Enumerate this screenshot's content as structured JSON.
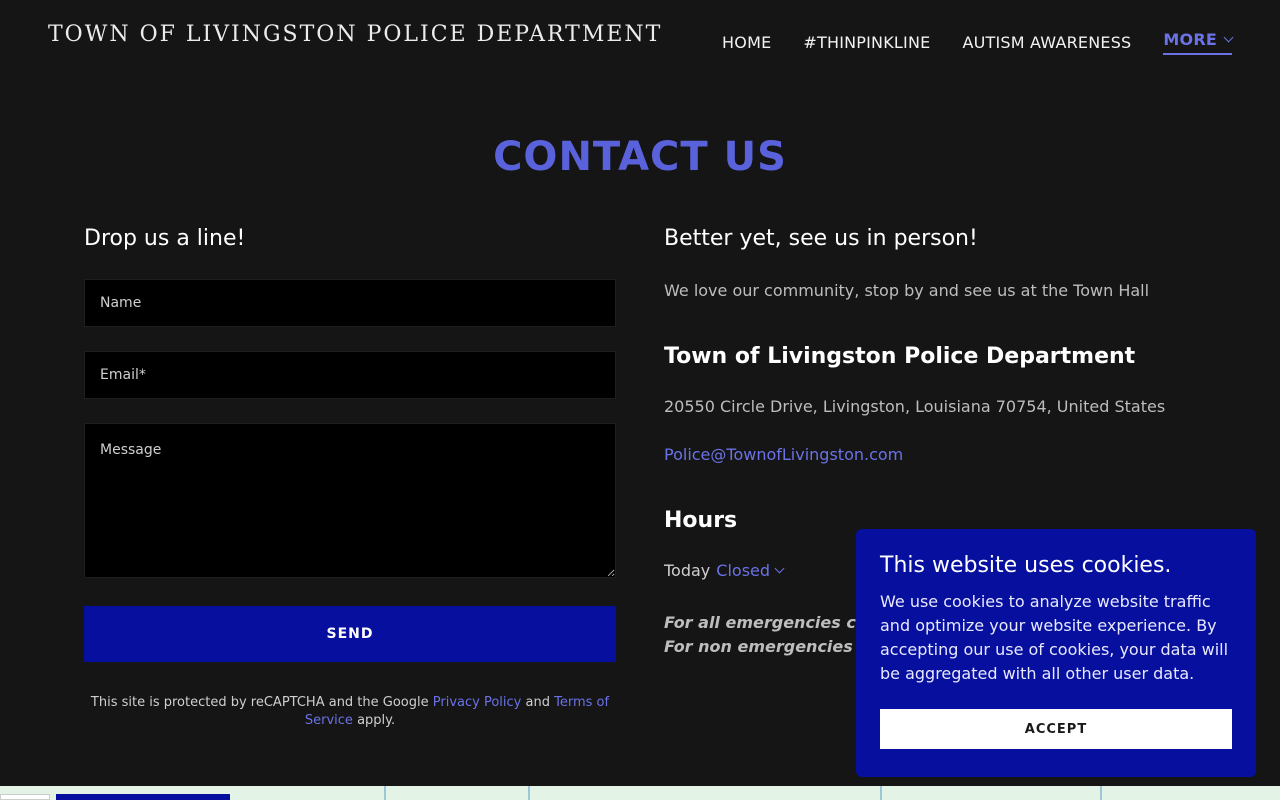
{
  "header": {
    "site_title": "TOWN OF LIVINGSTON POLICE DEPARTMENT",
    "nav": {
      "home": "HOME",
      "thinpinkline": "#THINPINKLINE",
      "autism": "AUTISM AWARENESS",
      "more": "MORE"
    }
  },
  "page": {
    "heading": "CONTACT US"
  },
  "form": {
    "title": "Drop us a line!",
    "name_placeholder": "Name",
    "email_placeholder": "Email*",
    "message_placeholder": "Message",
    "send_label": "SEND",
    "recaptcha_prefix": "This site is protected by reCAPTCHA and the Google",
    "privacy_link": "Privacy Policy",
    "and_text": "and",
    "terms_link": "Terms of Service",
    "apply_text": "apply."
  },
  "info": {
    "title": "Better yet, see us in person!",
    "text": "We love our community, stop by and see us at the Town Hall",
    "org_name": "Town of Livingston Police Department",
    "address": "20550 Circle Drive, Livingston, Louisiana 70754, United States",
    "email": "Police@TownofLivingston.com",
    "hours_title": "Hours",
    "hours_today_label": "Today",
    "hours_status": "Closed",
    "emergency_line1": "For all emergencies ca",
    "emergency_line2": "For non emergencies p"
  },
  "cookie": {
    "title": "This website uses cookies.",
    "text": "We use cookies to analyze website traffic and optimize your website experience. By accepting our use of cookies, your data will be aggregated with all other user data.",
    "accept_label": "ACCEPT"
  },
  "colors": {
    "accent": "#5a62db",
    "link": "#6a72e6",
    "button": "#07109e",
    "background": "#151515"
  }
}
